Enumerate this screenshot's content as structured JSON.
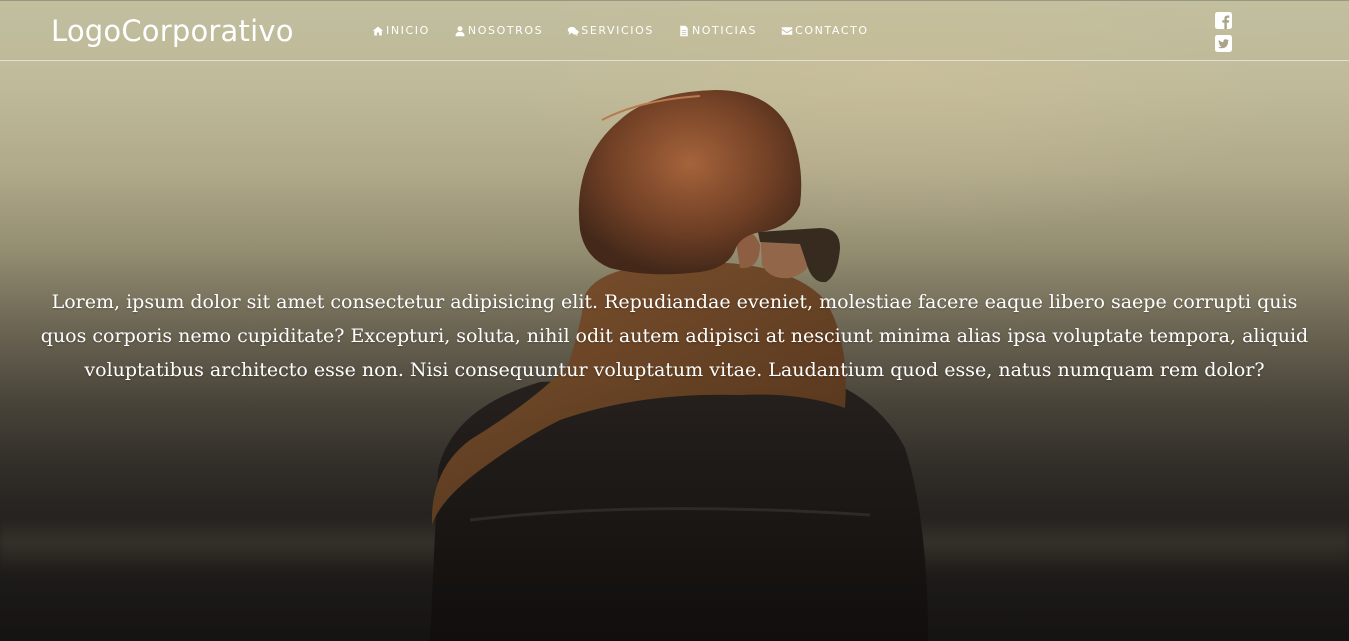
{
  "brand": {
    "logo_text": "LogoCorporativo"
  },
  "nav": {
    "items": [
      {
        "label": "INICIO",
        "icon": "home-icon"
      },
      {
        "label": "NOSOTROS",
        "icon": "user-icon"
      },
      {
        "label": "SERVICIOS",
        "icon": "comments-icon"
      },
      {
        "label": "NOTICIAS",
        "icon": "file-icon"
      },
      {
        "label": "CONTACTO",
        "icon": "envelope-icon"
      }
    ]
  },
  "social": [
    {
      "network": "facebook",
      "icon": "facebook-icon"
    },
    {
      "network": "twitter",
      "icon": "twitter-icon"
    }
  ],
  "hero": {
    "text": "Lorem, ipsum dolor sit amet consectetur adipisicing elit. Repudiandae eveniet, molestiae facere eaque libero saepe corrupti quis quos corporis nemo cupiditate? Excepturi, soluta, nihil odit autem adipisci at nesciunt minima alias ipsa voluptate tempora, aliquid voluptatibus architecto esse non. Nisi consequuntur voluptatum vitae. Laudantium quod esse, natus numquam rem dolor?"
  },
  "colors": {
    "nav_text": "#ffffff",
    "background_top": "#c9c6a6",
    "background_bottom": "#1c1a18"
  }
}
